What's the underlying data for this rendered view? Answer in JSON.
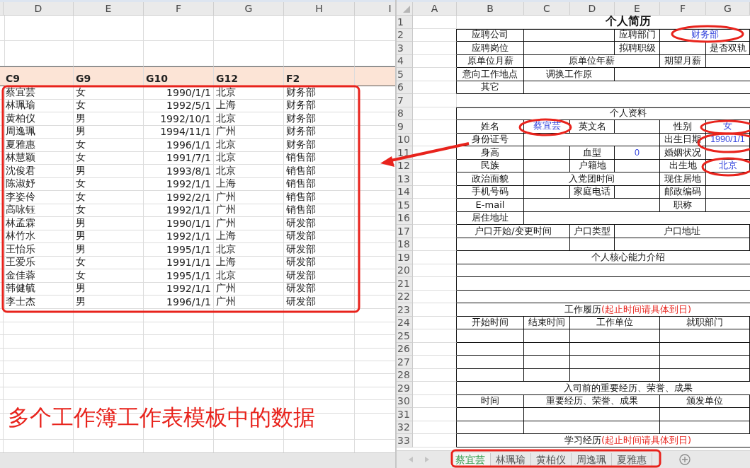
{
  "left_sheet": {
    "columns": [
      "D",
      "E",
      "F",
      "G",
      "H",
      "I"
    ],
    "header": [
      "C9",
      "G9",
      "G10",
      "G12",
      "F2"
    ],
    "rows": [
      [
        "蔡宜芸",
        "女",
        "1990/1/1",
        "北京",
        "财务部"
      ],
      [
        "林珮瑜",
        "女",
        "1992/5/1",
        "上海",
        "财务部"
      ],
      [
        "黄柏仪",
        "男",
        "1992/10/1",
        "北京",
        "财务部"
      ],
      [
        "周逸珮",
        "男",
        "1994/11/1",
        "广州",
        "财务部"
      ],
      [
        "夏雅惠",
        "女",
        "1996/1/1",
        "北京",
        "财务部"
      ],
      [
        "林慧颖",
        "女",
        "1991/7/1",
        "北京",
        "销售部"
      ],
      [
        "沈俊君",
        "男",
        "1993/8/1",
        "北京",
        "销售部"
      ],
      [
        "陈淑妤",
        "女",
        "1992/1/1",
        "上海",
        "销售部"
      ],
      [
        "李姿伶",
        "女",
        "1992/2/1",
        "广州",
        "销售部"
      ],
      [
        "高咏钰",
        "女",
        "1992/1/1",
        "广州",
        "销售部"
      ],
      [
        "林孟霖",
        "男",
        "1990/1/1",
        "广州",
        "研发部"
      ],
      [
        "林竹水",
        "男",
        "1992/1/1",
        "上海",
        "研发部"
      ],
      [
        "王怡乐",
        "男",
        "1995/1/1",
        "北京",
        "研发部"
      ],
      [
        "王爱乐",
        "女",
        "1991/1/1",
        "上海",
        "研发部"
      ],
      [
        "金佳蓉",
        "女",
        "1995/1/1",
        "北京",
        "研发部"
      ],
      [
        "韩健毓",
        "男",
        "1992/1/1",
        "广州",
        "研发部"
      ],
      [
        "李士杰",
        "男",
        "1996/1/1",
        "广州",
        "研发部"
      ]
    ]
  },
  "caption": "多个工作簿工作表模板中的数据",
  "form": {
    "columns": [
      "A",
      "B",
      "C",
      "D",
      "E",
      "F",
      "G"
    ],
    "rows": [
      {
        "number": "1",
        "cells": [
          {
            "kind": "title",
            "text": "个人简历"
          }
        ]
      },
      {
        "number": "2",
        "cells": [
          {
            "kind": "label",
            "text": "应聘公司"
          },
          {
            "kind": "label",
            "text": "应聘部门"
          },
          {
            "kind": "value",
            "text": "财务部"
          }
        ]
      },
      {
        "number": "3",
        "cells": [
          {
            "kind": "label",
            "text": "应聘岗位"
          },
          {
            "kind": "label",
            "text": "拟聘职级"
          },
          {
            "kind": "label",
            "text": "是否双轨"
          }
        ]
      },
      {
        "number": "4",
        "cells": [
          {
            "kind": "label",
            "text": "原单位月薪"
          },
          {
            "kind": "label",
            "text": "原单位年薪"
          },
          {
            "kind": "label",
            "text": "期望月薪"
          }
        ]
      },
      {
        "number": "5",
        "cells": [
          {
            "kind": "label",
            "text": "意向工作地点"
          },
          {
            "kind": "label",
            "text": "调换工作原"
          }
        ]
      },
      {
        "number": "6",
        "cells": [
          {
            "kind": "label",
            "text": "其它"
          }
        ]
      },
      {
        "number": "7"
      },
      {
        "number": "8",
        "cells": [
          {
            "kind": "heading",
            "text": "个人资料"
          }
        ]
      },
      {
        "number": "9",
        "cells": [
          {
            "kind": "label",
            "text": "姓名"
          },
          {
            "kind": "value",
            "text": "蔡宜芸"
          },
          {
            "kind": "label",
            "text": "英文名"
          },
          {
            "kind": "label",
            "text": "性别"
          },
          {
            "kind": "value",
            "text": "女"
          }
        ]
      },
      {
        "number": "10",
        "cells": [
          {
            "kind": "label",
            "text": "身份证号"
          },
          {
            "kind": "label",
            "text": "出生日期"
          },
          {
            "kind": "value",
            "text": "1990/1/1"
          }
        ]
      },
      {
        "number": "11",
        "cells": [
          {
            "kind": "label",
            "text": "身高"
          },
          {
            "kind": "label",
            "text": "血型"
          },
          {
            "kind": "value",
            "text": "0"
          },
          {
            "kind": "label",
            "text": "婚姻状况"
          }
        ]
      },
      {
        "number": "12",
        "cells": [
          {
            "kind": "label",
            "text": "民族"
          },
          {
            "kind": "label",
            "text": "户籍地"
          },
          {
            "kind": "label",
            "text": "出生地"
          },
          {
            "kind": "value",
            "text": "北京"
          }
        ]
      },
      {
        "number": "13",
        "cells": [
          {
            "kind": "label",
            "text": "政治面貌"
          },
          {
            "kind": "label",
            "text": "入党团时间"
          },
          {
            "kind": "label",
            "text": "现住居地"
          }
        ]
      },
      {
        "number": "14",
        "cells": [
          {
            "kind": "label",
            "text": "手机号码"
          },
          {
            "kind": "label",
            "text": "家庭电话"
          },
          {
            "kind": "label",
            "text": "邮政编码"
          }
        ]
      },
      {
        "number": "15",
        "cells": [
          {
            "kind": "label",
            "text": "E-mail"
          },
          {
            "kind": "label",
            "text": "职称"
          }
        ]
      },
      {
        "number": "16",
        "cells": [
          {
            "kind": "label",
            "text": "居住地址"
          }
        ]
      },
      {
        "number": "17",
        "cells": [
          {
            "kind": "label",
            "text": "户口开始/变更时间"
          },
          {
            "kind": "label",
            "text": "户口类型"
          },
          {
            "kind": "label",
            "text": "户口地址"
          }
        ]
      },
      {
        "number": "18"
      },
      {
        "number": "19",
        "cells": [
          {
            "kind": "heading",
            "text": "个人核心能力介绍"
          }
        ]
      },
      {
        "number": "20"
      },
      {
        "number": "21"
      },
      {
        "number": "22"
      },
      {
        "number": "23",
        "cells": [
          {
            "kind": "heading",
            "text": "工作履历",
            "note": "(起止时间请具体到日)"
          }
        ]
      },
      {
        "number": "24",
        "cells": [
          {
            "kind": "label",
            "text": "开始时间"
          },
          {
            "kind": "label",
            "text": "结束时间"
          },
          {
            "kind": "label",
            "text": "工作单位"
          },
          {
            "kind": "label",
            "text": "就职部门"
          }
        ]
      },
      {
        "number": "25"
      },
      {
        "number": "26"
      },
      {
        "number": "27"
      },
      {
        "number": "28"
      },
      {
        "number": "29",
        "cells": [
          {
            "kind": "heading",
            "text": "入司前的重要经历、荣誉、成果"
          }
        ]
      },
      {
        "number": "30",
        "cells": [
          {
            "kind": "label",
            "text": "时间"
          },
          {
            "kind": "label",
            "text": "重要经历、荣誉、成果"
          },
          {
            "kind": "label",
            "text": "颁发单位"
          }
        ]
      },
      {
        "number": "31"
      },
      {
        "number": "32"
      },
      {
        "number": "33",
        "cells": [
          {
            "kind": "heading",
            "text": "学习经历",
            "note": "(起止时间请具体到日)"
          }
        ]
      }
    ]
  },
  "sheet_tabs": [
    {
      "label": "蔡宜芸",
      "selected": true
    },
    {
      "label": "林珮瑜",
      "selected": false
    },
    {
      "label": "黄柏仪",
      "selected": false
    },
    {
      "label": "周逸珮",
      "selected": false
    },
    {
      "label": "夏雅惠",
      "selected": false
    }
  ]
}
